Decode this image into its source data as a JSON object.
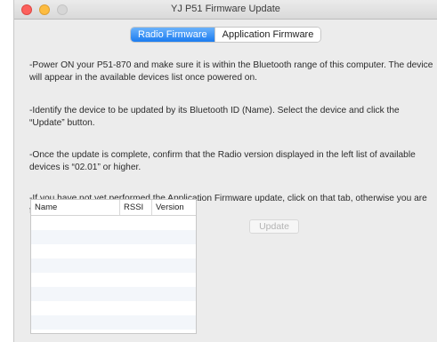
{
  "window": {
    "title": "YJ P51 Firmware Update"
  },
  "tabs": [
    {
      "label": "Radio Firmware",
      "selected": true
    },
    {
      "label": "Application Firmware",
      "selected": false
    }
  ],
  "instructions": [
    "-Power ON your P51-870 and make sure it is within the Bluetooth range of this computer. The device will appear in the available devices list once powered on.",
    "-Identify the device to be updated by its Bluetooth ID (Name). Select the device and click the “Update” button.",
    "-Once the update is complete, confirm that the Radio version displayed in the left list of available devices is “02.01” or higher.",
    "-If you have not yet performed the Application Firmware update, click on that tab, otherwise you are finished."
  ],
  "devices_table": {
    "columns": [
      "Name",
      "RSSI",
      "Version"
    ],
    "rows": []
  },
  "update_button": {
    "label": "Update",
    "enabled": false
  },
  "colors": {
    "accent": "#1c7cf0",
    "close": "#fc605c",
    "minimize": "#fdbc40",
    "zoom_disabled": "#d6d6d6"
  }
}
